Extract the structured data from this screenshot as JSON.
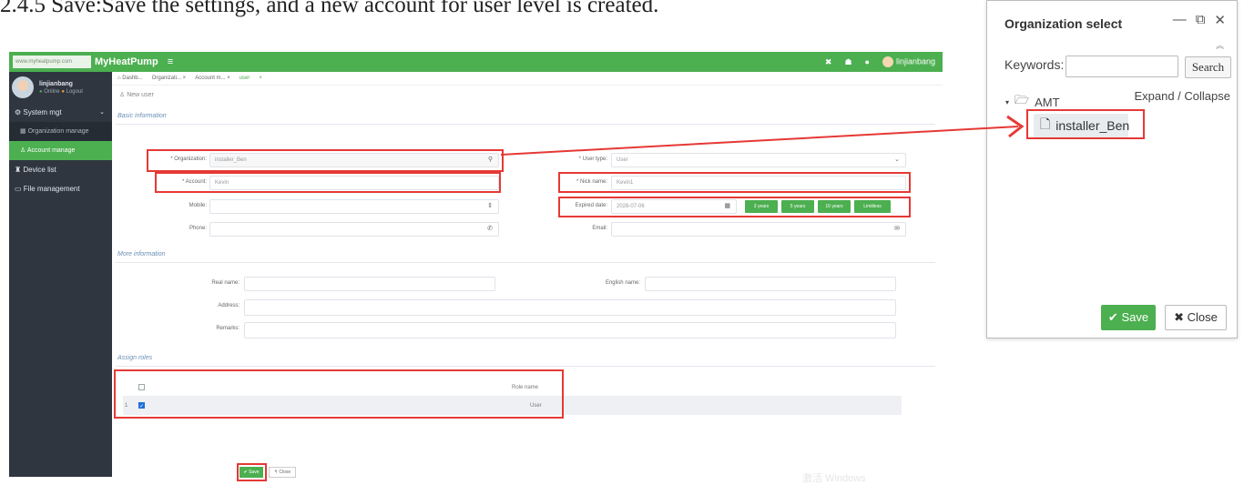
{
  "doc": {
    "heading": "2.4.5 Save:Save the settings, and a new account for user level is created."
  },
  "app": {
    "site_badge": "www.myheatpump.com",
    "brand": "MyHeatPump",
    "menu_icon": "≡",
    "user_top": "linjianbang",
    "user_panel": {
      "name": "linjianbang",
      "online": "Online",
      "logout": "Logout"
    },
    "sidebar": {
      "system_mgt": "System mgt",
      "org_manage": "Organization manage",
      "account_manage": "Account manage",
      "device_list": "Device list",
      "file_management": "File management"
    },
    "tabs": [
      "Dashb...",
      "Organizati... ×",
      "Account m... ×",
      "user"
    ],
    "page_sub": "New user",
    "sections": {
      "basic": "Basic information",
      "more": "More information",
      "roles": "Assign roles"
    },
    "form": {
      "organization_label": "* Organization:",
      "organization_value": "installer_Ben",
      "user_type_label": "* User type:",
      "user_type_value": "User",
      "account_label": "* Account:",
      "account_value": "Kevin",
      "nick_name_label": "* Nick name:",
      "nick_name_value": "Kevin1",
      "mobile_label": "Mobile:",
      "expired_label": "Expired date:",
      "expired_value": "2028-07-06",
      "phone_label": "Phone:",
      "email_label": "Email:",
      "year_buttons": [
        "3 years",
        "5 years",
        "10 years",
        "Limitless"
      ],
      "real_name_label": "Real name:",
      "english_name_label": "English name:",
      "address_label": "Address:",
      "remarks_label": "Remarks:"
    },
    "roles": {
      "header": "Role name",
      "row_index": "1",
      "row_value": "User"
    },
    "buttons": {
      "save": "✔ Save",
      "close": "↰ Close"
    },
    "watermark": "激活 Windows"
  },
  "dialog": {
    "title": "Organization select",
    "keywords_label": "Keywords:",
    "search_button": "Search",
    "tree_root": "AMT",
    "expand_collapse": "Expand / Collapse",
    "selected_node": "installer_Ben",
    "save_button": "Save",
    "close_button": "Close"
  },
  "colors": {
    "accent": "#4caf50",
    "sidebar": "#2f3640",
    "highlight": "#e53935"
  }
}
